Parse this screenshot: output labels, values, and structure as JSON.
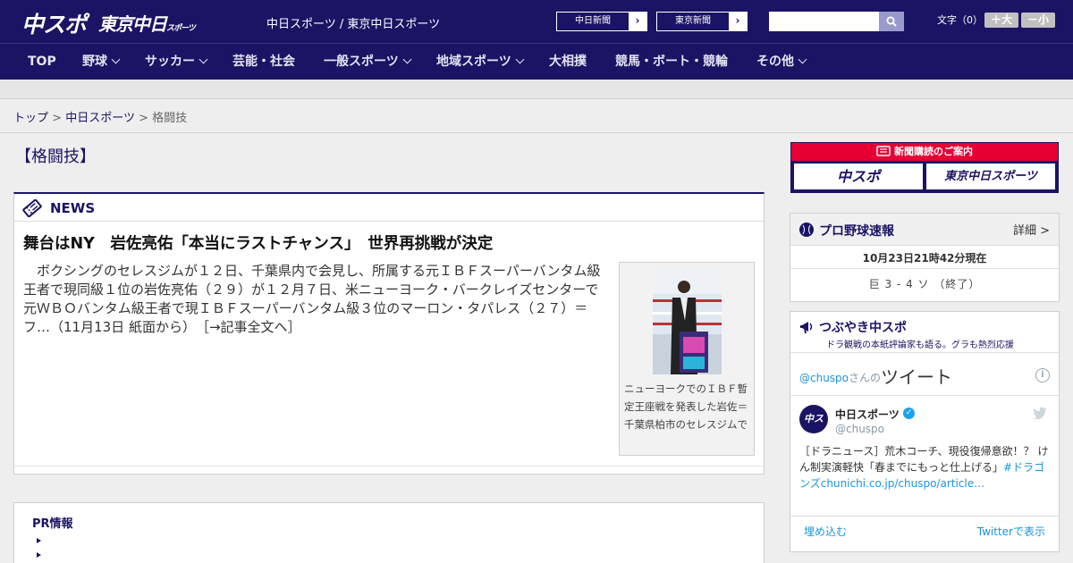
{
  "header": {
    "logo_chusupo": "中スポ",
    "logo_tokyo": "東京中日",
    "logo_tokyo_small": "スポーツ",
    "site_names": "中日スポーツ / 東京中日スポーツ",
    "paper_links": [
      {
        "label": "中日新聞",
        "arrow": "›"
      },
      {
        "label": "東京新聞",
        "arrow": "›"
      }
    ],
    "search_placeholder": "",
    "font_size_label": "文字（0）",
    "font_plus": "＋大",
    "font_minus": "－小",
    "colors": {
      "header_bg": "#1b1464",
      "accent": "#e60033"
    }
  },
  "nav": {
    "items": [
      {
        "label": "TOP",
        "has_dropdown": false
      },
      {
        "label": "野球",
        "has_dropdown": true
      },
      {
        "label": "サッカー",
        "has_dropdown": true
      },
      {
        "label": "芸能・社会",
        "has_dropdown": false
      },
      {
        "label": "一般スポーツ",
        "has_dropdown": true
      },
      {
        "label": "地域スポーツ",
        "has_dropdown": true
      },
      {
        "label": "大相撲",
        "has_dropdown": false
      },
      {
        "label": "競馬・ボート・競輪",
        "has_dropdown": false
      },
      {
        "label": "その他",
        "has_dropdown": true
      }
    ]
  },
  "breadcrumb": {
    "items": [
      "トップ",
      "中日スポーツ",
      "格闘技"
    ],
    "separator": ">"
  },
  "page": {
    "title": "【格闘技】"
  },
  "news": {
    "section_title": "NEWS",
    "headline": "舞台はNY　岩佐亮佑「本当にラストチャンス」　世界再挑戦が決定",
    "body": "　ボクシングのセレスジムが１２日、千葉県内で会見し、所属する元ＩＢＦスーパーバンタム級王者で現同級１位の岩佐亮佑（２９）が１２月７日、米ニューヨーク・バークレイズセンターで元ＷＢＯバンタム級王者で現ＩＢＦスーパーバンタム級３位のマーロン・タパレス（２７）＝フ…（11月13日 紙面から）　［→記事全文へ］",
    "photo_caption": "ニューヨークでのＩＢＦ暫定王座戦を発表した岩佐＝千葉県柏市のセレスジムで"
  },
  "pr": {
    "title": "PR情報",
    "items": [
      "",
      ""
    ]
  },
  "sidebar": {
    "subscription": {
      "label": "新聞購読のご案内",
      "tiles": [
        "中スポ",
        "東京中日スポーツ"
      ]
    },
    "baseball": {
      "title": "プロ野球速報",
      "detail_link": "詳細 >",
      "timestamp": "10月23日21時42分現在",
      "score_line": "巨 3 - 4 ソ （終了）"
    },
    "twitter": {
      "title": "つぶやき中スポ",
      "subtitle": "ドラ観戦の本紙評論家も語る。グラも熱烈応援",
      "handle": "@chuspo",
      "handle_suffix": "さんの",
      "tweet_label": "ツイート",
      "account_name": "中日スポーツ",
      "account_user": "@chuspo",
      "avatar_text": "中スポ",
      "tweet_text": "［ドラニュース］荒木コーチ、現役復帰意欲！？ けん制実演軽快「春までにもっと仕上げる」",
      "tweet_hashtag": "#ドラゴンズ",
      "tweet_link": "chunichi.co.jp/chuspo/article…",
      "embed_label": "埋め込む",
      "view_label": "Twitterで表示"
    }
  }
}
